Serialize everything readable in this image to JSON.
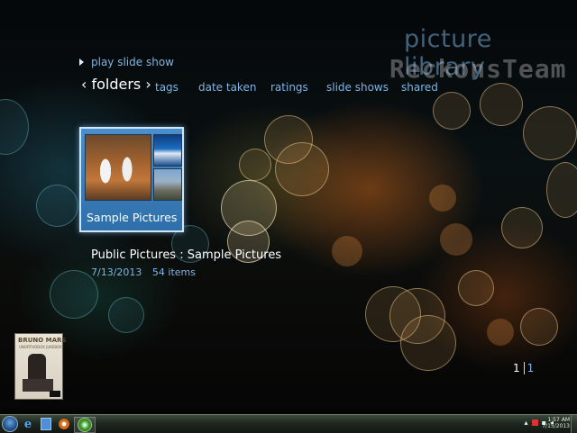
{
  "app": {
    "title": "picture library",
    "watermark": "ReckonsTeam"
  },
  "actions": {
    "play_slide_show": "play slide show"
  },
  "nav": {
    "active": "‹ folders ›",
    "tabs": [
      "tags",
      "date taken",
      "ratings",
      "slide shows",
      "shared"
    ]
  },
  "folder_tile": {
    "label": "Sample Pictures"
  },
  "details": {
    "path": "Public Pictures : Sample Pictures",
    "date": "7/13/2013",
    "count": "54 items"
  },
  "now_playing": {
    "album_title": "BRUNO MARS",
    "album_subtitle": "UNORTHODOX JUKEBOX"
  },
  "pager": {
    "current": "1",
    "total": "1"
  },
  "taskbar": {
    "icons": [
      "windows-start-icon",
      "internet-explorer-icon",
      "windows-explorer-icon",
      "media-player-icon",
      "media-center-icon"
    ],
    "tray_arrow": "▴",
    "clock_time": "1:57 AM",
    "clock_date": "7/15/2013"
  }
}
